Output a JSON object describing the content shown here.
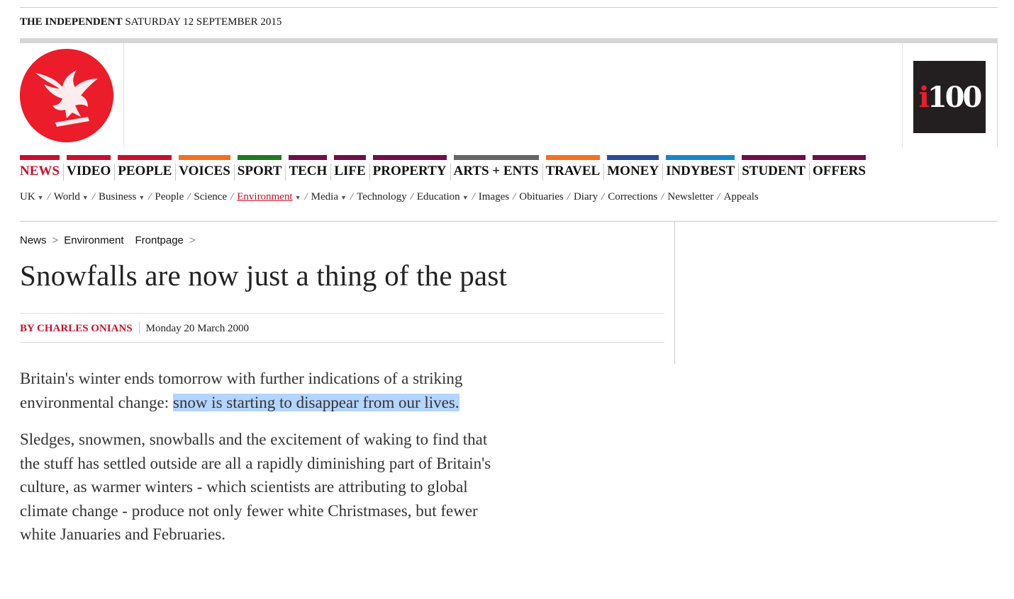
{
  "dateline": {
    "brand": "THE INDEPENDENT",
    "date": "SATURDAY 12 SEPTEMBER 2015"
  },
  "masthead": {
    "logo_icon": "eagle-icon",
    "badge_text": "100",
    "badge_prefix": "i"
  },
  "nav": [
    {
      "label": "NEWS",
      "color": "#c8102e",
      "active": true
    },
    {
      "label": "VIDEO",
      "color": "#c8102e"
    },
    {
      "label": "PEOPLE",
      "color": "#c8102e"
    },
    {
      "label": "VOICES",
      "color": "#f37021"
    },
    {
      "label": "SPORT",
      "color": "#1f7a1f"
    },
    {
      "label": "TECH",
      "color": "#6d0f4a"
    },
    {
      "label": "LIFE",
      "color": "#6d0f4a"
    },
    {
      "label": "PROPERTY",
      "color": "#6d0f4a"
    },
    {
      "label": "ARTS + ENTS",
      "color": "#666666"
    },
    {
      "label": "TRAVEL",
      "color": "#f37021"
    },
    {
      "label": "MONEY",
      "color": "#2b4b9b"
    },
    {
      "label": "INDYBEST",
      "color": "#1a86c8"
    },
    {
      "label": "STUDENT",
      "color": "#6d0f4a"
    },
    {
      "label": "OFFERS",
      "color": "#6d0f4a"
    }
  ],
  "subnav": [
    {
      "label": "UK",
      "caret": true
    },
    {
      "label": "World",
      "caret": true
    },
    {
      "label": "Business",
      "caret": true
    },
    {
      "label": "People"
    },
    {
      "label": "Science"
    },
    {
      "label": "Environment",
      "caret": true,
      "active": true
    },
    {
      "label": "Media",
      "caret": true
    },
    {
      "label": "Technology"
    },
    {
      "label": "Education",
      "caret": true
    },
    {
      "label": "Images"
    },
    {
      "label": "Obituaries"
    },
    {
      "label": "Diary"
    },
    {
      "label": "Corrections"
    },
    {
      "label": "Newsletter"
    },
    {
      "label": "Appeals"
    }
  ],
  "breadcrumb": {
    "items": [
      "News",
      "Environment",
      "Frontpage"
    ]
  },
  "article": {
    "headline": "Snowfalls are now just a thing of the past",
    "byline": "By Charles Onians",
    "date": "Monday 20 March 2000",
    "p1_before": "Britain's winter ends tomorrow with further indications of a striking environmental change: ",
    "p1_highlight": "snow is starting to disappear from our lives.",
    "p2": "Sledges, snowmen, snowballs and the excitement of waking to find that the stuff has settled outside are all a rapidly diminishing part of Britain's culture, as warmer winters - which scientists are attributing to global climate change - produce not only fewer white Christmases, but fewer white Januaries and Februaries."
  },
  "colors": {
    "brand_red": "#ec1c2b",
    "highlight": "#b4d5fe"
  }
}
